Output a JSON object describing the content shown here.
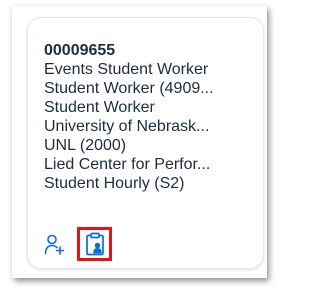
{
  "card": {
    "id": "00009655",
    "lines": [
      "Events Student Worker",
      "Student Worker (4909...",
      "Student Worker",
      "University of Nebrask...",
      "UNL (2000)",
      "Lied Center for Perfor...",
      "Student Hourly (S2)"
    ]
  },
  "actions": {
    "icons": [
      "add-user-icon",
      "clipboard-user-icon"
    ],
    "icon_color": "#0a6ed1",
    "highlight_color": "#e5121c"
  }
}
